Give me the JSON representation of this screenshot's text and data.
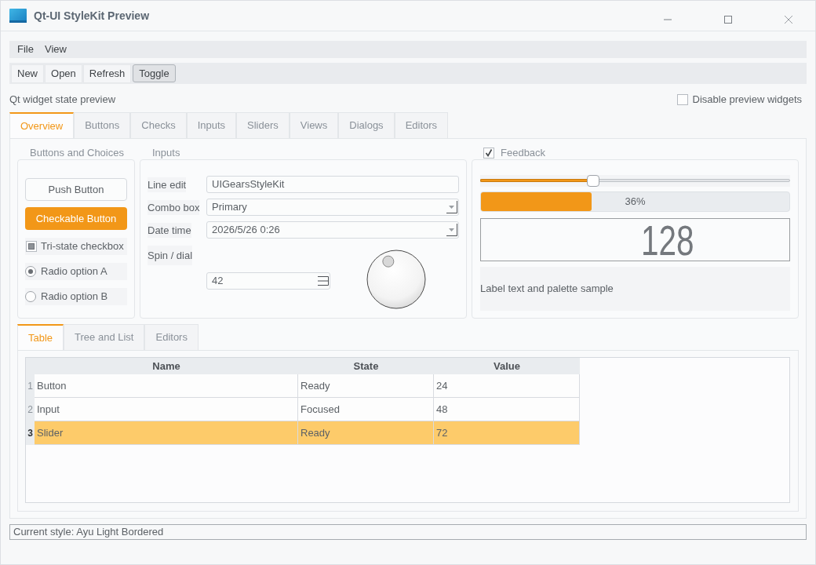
{
  "window": {
    "title": "Qt-UI StyleKit Preview"
  },
  "menu_bar": {
    "items": [
      "File",
      "View"
    ]
  },
  "toolbar": {
    "items": [
      {
        "label": "New",
        "checked": false
      },
      {
        "label": "Open",
        "checked": false
      },
      {
        "label": "Refresh",
        "checked": false
      },
      {
        "label": "Toggle",
        "checked": true
      }
    ]
  },
  "header": {
    "caption": "Qt widget state preview",
    "disable_widgets": {
      "label": "Disable preview widgets",
      "checked": false
    }
  },
  "main_tabs": [
    {
      "label": "Overview",
      "selected": true
    },
    {
      "label": "Buttons",
      "selected": false
    },
    {
      "label": "Checks",
      "selected": false
    },
    {
      "label": "Inputs",
      "selected": false
    },
    {
      "label": "Sliders",
      "selected": false
    },
    {
      "label": "Views",
      "selected": false
    },
    {
      "label": "Dialogs",
      "selected": false
    },
    {
      "label": "Editors",
      "selected": false
    }
  ],
  "overview": {
    "buttons_group": {
      "title": "Buttons and Choices",
      "push_button": {
        "label": "Push Button"
      },
      "checkable_button": {
        "label": "Checkable Button",
        "checked": true
      },
      "checkbox": {
        "label": "Tri-state checkbox",
        "partially_checked": true
      },
      "radios": [
        {
          "label": "Radio option A",
          "selected": true
        },
        {
          "label": "Radio option B",
          "selected": false
        }
      ]
    },
    "inputs_group": {
      "title": "Inputs",
      "line_edit": {
        "label": "Line edit",
        "value": "UIGearsStyleKit"
      },
      "combo_box": {
        "label": "Combo box",
        "value": "Primary"
      },
      "date_time": {
        "label": "Date time",
        "value": "2026/5/26 0:26"
      },
      "spin_dial": {
        "label": "Spin / dial",
        "spin_value": "42",
        "dial": {
          "level": 0.42
        }
      }
    },
    "feedback_group": {
      "title": "Feedback",
      "checked": true,
      "slider": {
        "level": 0.36
      },
      "progress": {
        "level": 0.36,
        "text": "36%"
      },
      "lcd": {
        "value": "128"
      },
      "label": {
        "text": "Label text and palette sample"
      }
    }
  },
  "bottom_tabs": [
    {
      "label": "Table",
      "selected": true
    },
    {
      "label": "Tree and List",
      "selected": false
    },
    {
      "label": "Editors",
      "selected": false
    }
  ],
  "table": {
    "columns": [
      "Name",
      "State",
      "Value"
    ],
    "rows": [
      {
        "number": "1",
        "selected": false,
        "cells": [
          "Button",
          "Ready",
          "24"
        ]
      },
      {
        "number": "2",
        "selected": false,
        "cells": [
          "Input",
          "Focused",
          "48"
        ]
      },
      {
        "number": "3",
        "selected": true,
        "cells": [
          "Slider",
          "Ready",
          "72"
        ]
      }
    ]
  },
  "status_bar": {
    "text": "Current style: Ayu Light Bordered"
  }
}
